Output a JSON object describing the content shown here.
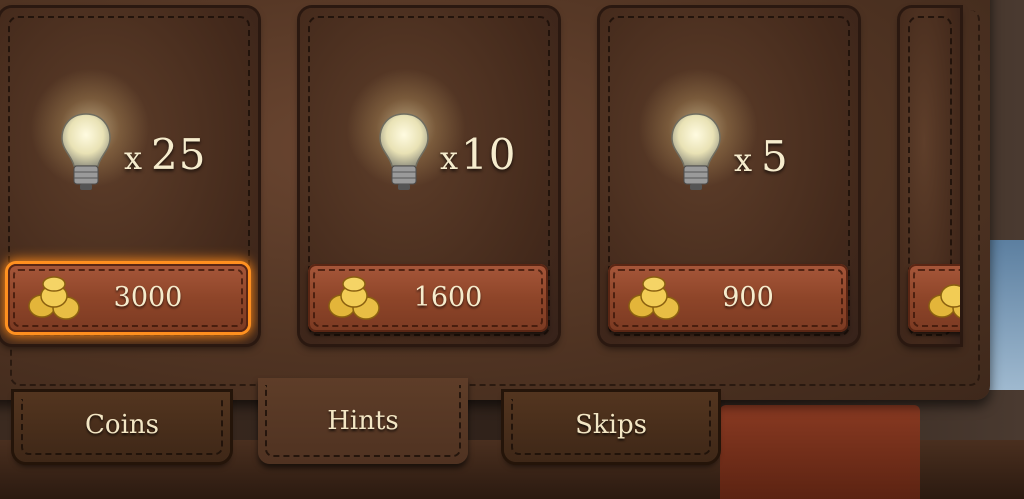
{
  "cards": [
    {
      "quantity_prefix": "x",
      "quantity": "25",
      "price": "3000",
      "selected": true
    },
    {
      "quantity_prefix": "x",
      "quantity": "10",
      "price": "1600",
      "selected": false
    },
    {
      "quantity_prefix": "x",
      "quantity": "5",
      "price": "900",
      "selected": false
    }
  ],
  "tabs": [
    {
      "label": "Coins",
      "active": false
    },
    {
      "label": "Hints",
      "active": true
    },
    {
      "label": "Skips",
      "active": false
    }
  ],
  "colors": {
    "accent_glow": "#ff8a1a",
    "text": "#f6eccd",
    "leather": "#4f3322"
  },
  "icons": {
    "item": "lightbulb-icon",
    "currency": "gold-coins-icon"
  }
}
